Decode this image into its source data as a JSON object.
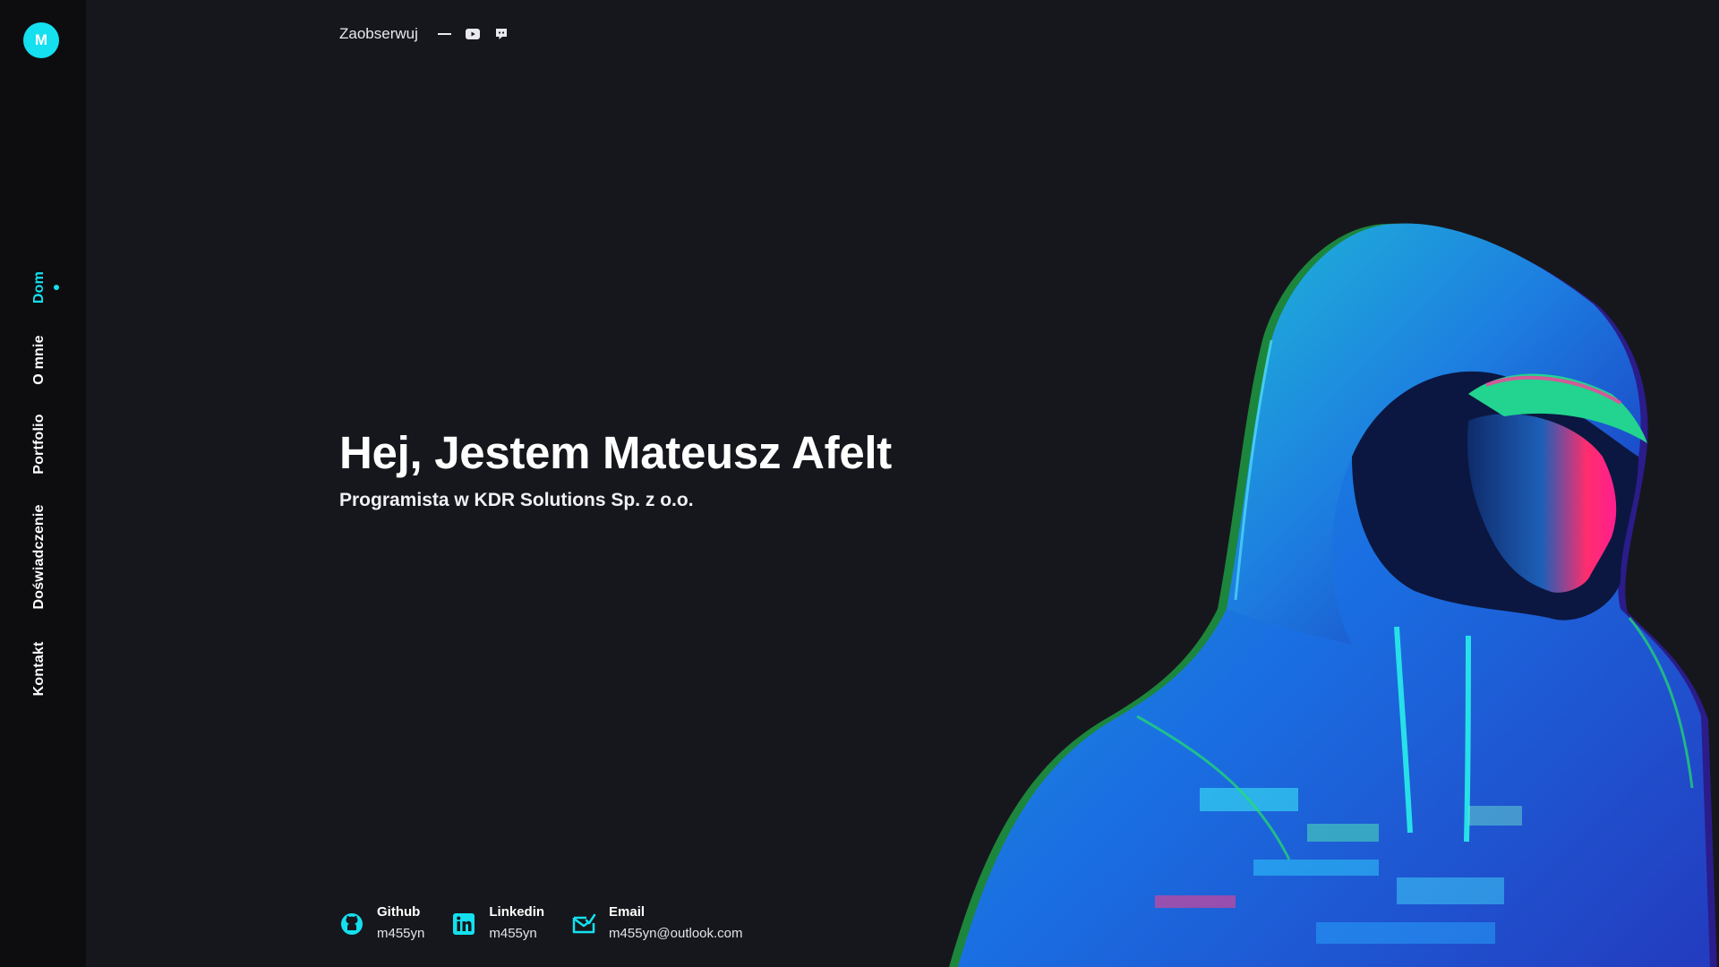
{
  "sidebar": {
    "logo_letter": "M",
    "items": [
      {
        "label": "Dom",
        "active": true
      },
      {
        "label": "O mnie",
        "active": false
      },
      {
        "label": "Portfolio",
        "active": false
      },
      {
        "label": "Doświadczenie",
        "active": false
      },
      {
        "label": "Kontakt",
        "active": false
      }
    ]
  },
  "follow": {
    "label": "Zaobserwuj",
    "icons": [
      "youtube-icon",
      "discord-icon"
    ]
  },
  "hero": {
    "title": "Hej, Jestem Mateusz Afelt",
    "subtitle": "Programista w KDR Solutions Sp. z o.o."
  },
  "contacts": [
    {
      "icon": "github-icon",
      "label": "Github",
      "value": "m455yn"
    },
    {
      "icon": "linkedin-icon",
      "label": "Linkedin",
      "value": "m455yn"
    },
    {
      "icon": "email-icon",
      "label": "Email",
      "value": "m455yn@outlook.com"
    }
  ],
  "colors": {
    "accent": "#14e0ef",
    "background": "#16171c",
    "sidebar": "#0d0d10"
  }
}
